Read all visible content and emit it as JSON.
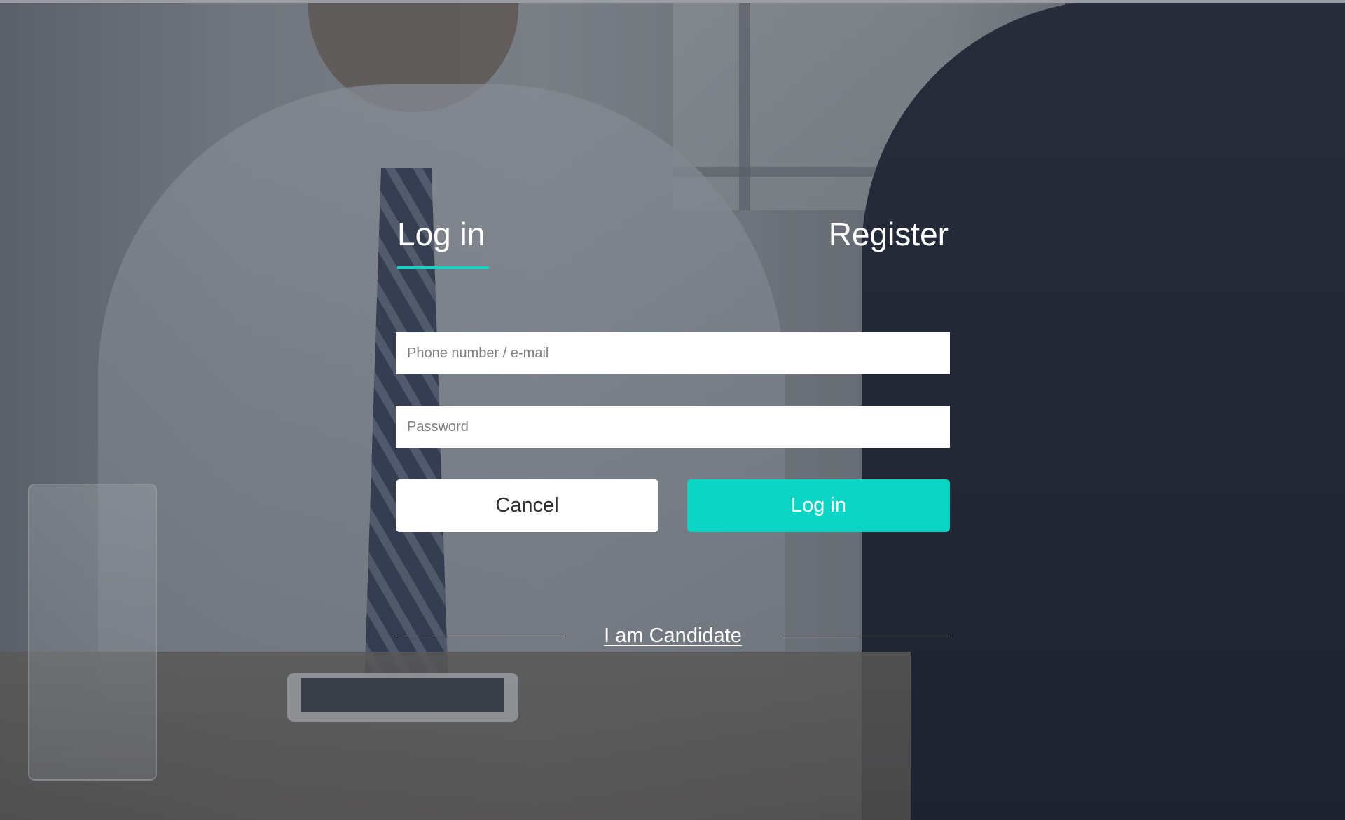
{
  "tabs": {
    "login_label": "Log in",
    "register_label": "Register"
  },
  "form": {
    "phone_placeholder": "Phone number / e-mail",
    "phone_value": "",
    "password_placeholder": "Password",
    "password_value": ""
  },
  "buttons": {
    "cancel_label": "Cancel",
    "login_label": "Log in"
  },
  "candidate_link": "I am Candidate",
  "colors": {
    "accent": "#0bd4c5",
    "tab_underline": "#12d3c4",
    "text_on_dark": "#ffffff",
    "cancel_text": "#2f2f2f"
  }
}
